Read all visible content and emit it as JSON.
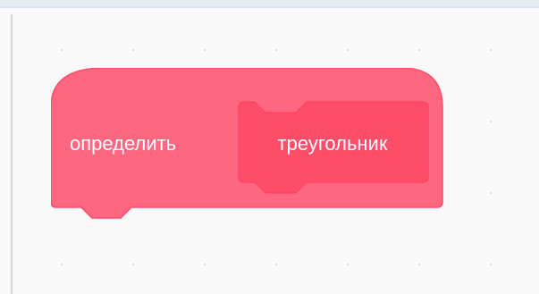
{
  "workspace": {
    "block": {
      "define_label": "определить",
      "procedure_name": "треугольник",
      "colors": {
        "block_fill": "#ff6680",
        "block_stroke": "#ff4d6a",
        "inner_fill": "#ff4d6a",
        "text": "#ffffff"
      }
    }
  }
}
